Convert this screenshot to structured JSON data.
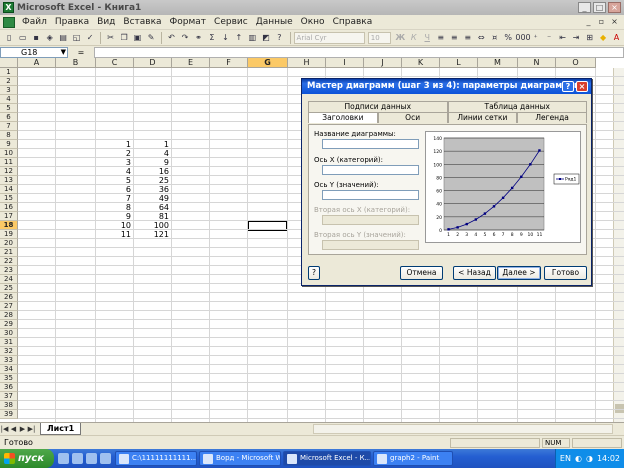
{
  "window": {
    "title": "Microsoft Excel - Книга1"
  },
  "menu": [
    "Файл",
    "Правка",
    "Вид",
    "Вставка",
    "Формат",
    "Сервис",
    "Данные",
    "Окно",
    "Справка"
  ],
  "toolbar": {
    "font": "Arial Cyr",
    "size": "10"
  },
  "formula": {
    "namebox": "G18",
    "fx": "="
  },
  "columns": [
    "A",
    "B",
    "C",
    "D",
    "E",
    "F",
    "G",
    "H",
    "I",
    "J",
    "K",
    "L",
    "M",
    "N",
    "O"
  ],
  "rows": [
    "1",
    "2",
    "3",
    "4",
    "5",
    "6",
    "7",
    "8",
    "9",
    "10",
    "11",
    "12",
    "13",
    "14",
    "15",
    "16",
    "17",
    "18",
    "19",
    "20",
    "21",
    "22",
    "23",
    "24",
    "25",
    "26",
    "27",
    "28",
    "29",
    "30",
    "31",
    "32",
    "33",
    "34",
    "35",
    "36",
    "37",
    "38",
    "39"
  ],
  "cells": {
    "C": [
      "1",
      "2",
      "3",
      "4",
      "5",
      "6",
      "7",
      "8",
      "9",
      "10",
      "11"
    ],
    "D": [
      "1",
      "4",
      "9",
      "16",
      "25",
      "36",
      "49",
      "64",
      "81",
      "100",
      "121"
    ]
  },
  "sheet": {
    "tab": "Лист1"
  },
  "status": {
    "text": "Готово",
    "num": "NUM"
  },
  "dialog": {
    "title": "Мастер диаграмм (шаг 3 из 4): параметры диаграммы",
    "tabs_top": [
      "Подписи данных",
      "Таблица данных"
    ],
    "tabs_bottom": [
      "Заголовки",
      "Оси",
      "Линии сетки",
      "Легенда"
    ],
    "fields": {
      "chart_title": "Название диаграммы:",
      "x_axis": "Ось X (категорий):",
      "y_axis": "Ось Y (значений):",
      "x2_axis": "Вторая ось X (категорий):",
      "y2_axis": "Вторая ось Y (значений):"
    },
    "buttons": {
      "cancel": "Отмена",
      "back": "< Назад",
      "next": "Далее >",
      "finish": "Готово",
      "help": "?"
    },
    "legend_label": "Ряд1"
  },
  "chart_data": {
    "type": "line",
    "categories": [
      "1",
      "2",
      "3",
      "4",
      "5",
      "6",
      "7",
      "8",
      "9",
      "10",
      "11"
    ],
    "series": [
      {
        "name": "Ряд1",
        "values": [
          1,
          4,
          9,
          16,
          25,
          36,
          49,
          64,
          81,
          100,
          121
        ]
      }
    ],
    "ylim": [
      0,
      140
    ],
    "yticks": [
      "0",
      "20",
      "40",
      "60",
      "80",
      "100",
      "120",
      "140"
    ],
    "grid": true,
    "legend": "right"
  },
  "taskbar": {
    "start": "пуск",
    "items": [
      "C:\\11111111111...",
      "Ворд - Microsoft W...",
      "Microsoft Excel - К...",
      "graph2 - Paint"
    ],
    "lang": "EN",
    "clock": "14:02"
  }
}
